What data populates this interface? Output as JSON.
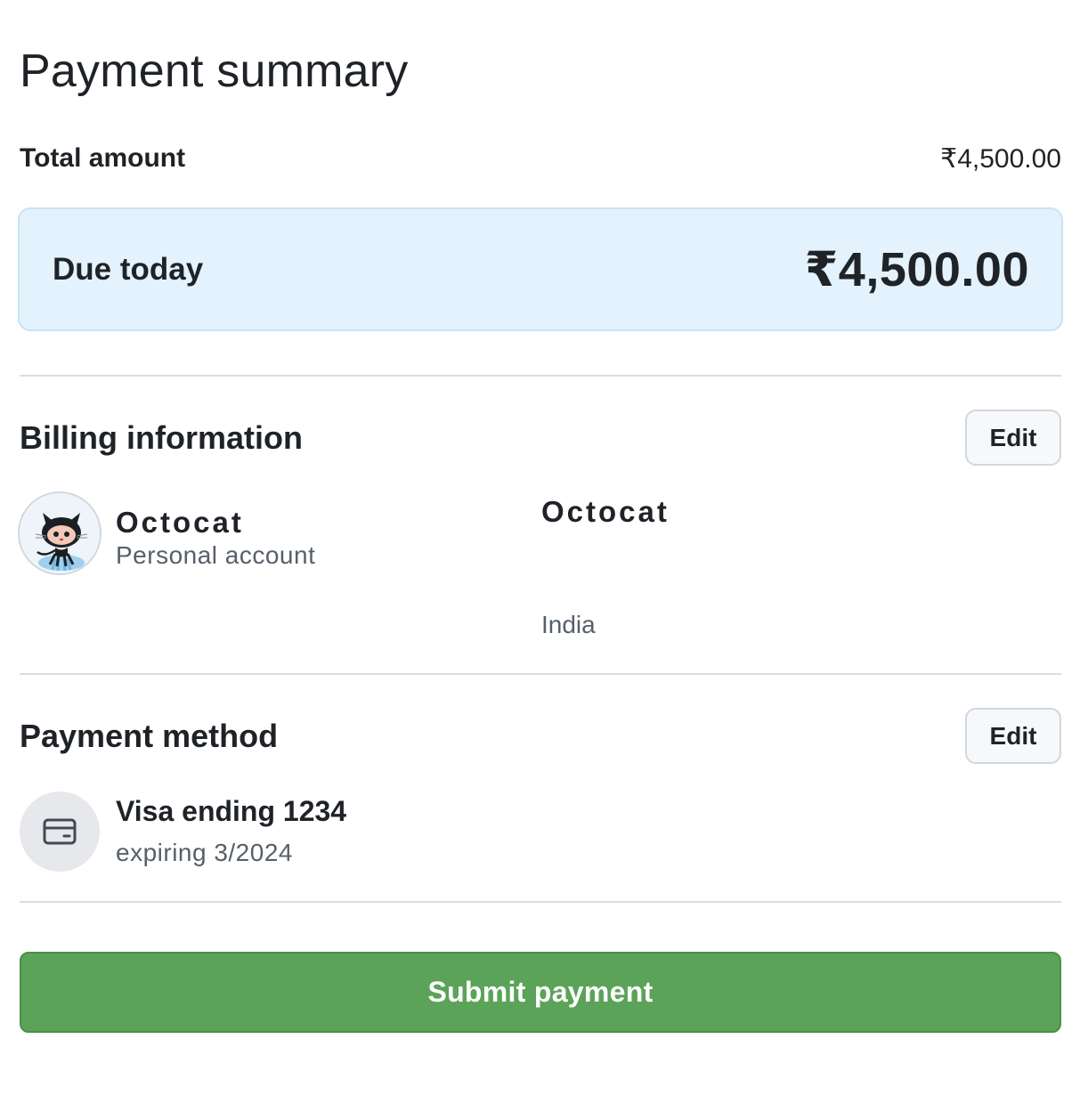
{
  "page": {
    "title": "Payment summary"
  },
  "totals": {
    "total_label": "Total amount",
    "total_value": "₹4,500.00",
    "due_label": "Due today",
    "due_value": "₹4,500.00",
    "due_box_color": "#e3f2fc"
  },
  "billing": {
    "title": "Billing information",
    "edit_label": "Edit",
    "account_name": "Octocat",
    "account_type": "Personal account",
    "avatar_icon": "octocat-avatar",
    "billing_name": "Octocat",
    "country": "India"
  },
  "payment_method": {
    "title": "Payment method",
    "edit_label": "Edit",
    "icon": "credit-card-icon",
    "card_brand_text": "Visa ending ",
    "card_last4": "1234",
    "expiry": "expiring 3/2024"
  },
  "actions": {
    "submit_label": "Submit payment",
    "submit_color": "#5ba358"
  }
}
